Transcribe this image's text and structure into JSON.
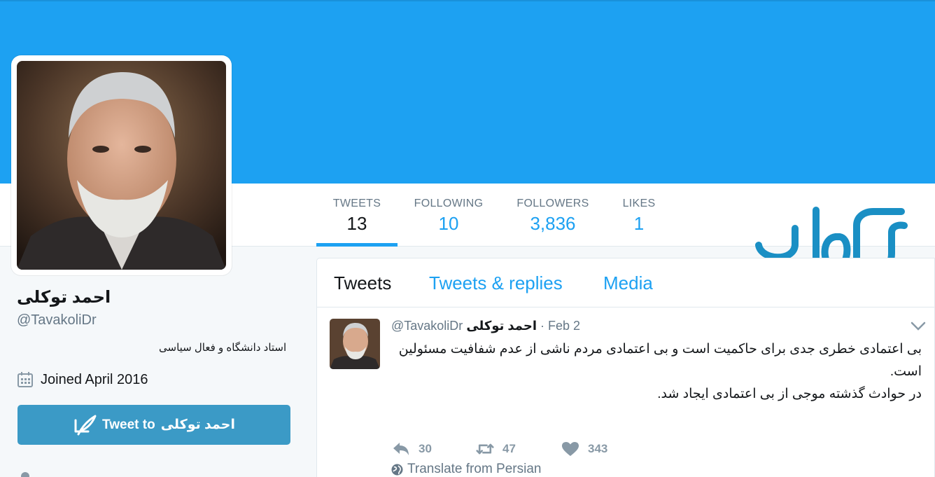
{
  "profile": {
    "name": "احمد توکلی",
    "handle": "@TavakoliDr",
    "bio": "استاد دانشگاه و فعال سیاسی",
    "joined": "Joined April 2016",
    "tweet_to_prefix": "Tweet to",
    "tweet_to_name": "احمد توکلی"
  },
  "stats": [
    {
      "label": "TWEETS",
      "value": "13"
    },
    {
      "label": "FOLLOWING",
      "value": "10"
    },
    {
      "label": "FOLLOWERS",
      "value": "3,836"
    },
    {
      "label": "LIKES",
      "value": "1"
    }
  ],
  "tabs": [
    "Tweets",
    "Tweets & replies",
    "Media"
  ],
  "tweet": {
    "handle": "@TavakoliDr",
    "name": "احمد توکلی",
    "dot": "·",
    "date": "Feb 2",
    "line1": "بی اعتمادی خطری جدی برای حاکمیت است و بی اعتمادی مردم ناشی از عدم شفافیت مسئولین است.",
    "line2": "در حوادث گذشته موجی از بی اعتمادی ایجاد شد.",
    "translate": "Translate from Persian",
    "replies": "30",
    "retweets": "47",
    "likes": "343"
  },
  "colors": {
    "accent": "#1da1f2",
    "button": "#3b9ac6",
    "logo": "#1a8fc4"
  }
}
